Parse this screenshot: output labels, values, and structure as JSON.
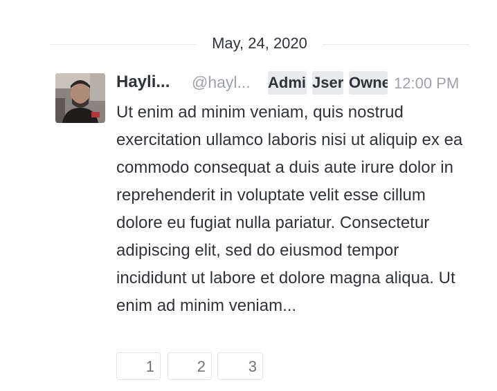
{
  "date_divider": {
    "label": "May, 24, 2020"
  },
  "message": {
    "username": "Hayli...",
    "handle": "@hayl...",
    "roles": [
      "Admir",
      "Jser",
      "Owne"
    ],
    "time": "12:00 PM",
    "body": "Ut enim ad minim veniam, quis nostrud exercitation ullamco laboris nisi ut aliquip ex ea commodo consequat a duis aute irure dolor in reprehenderit in voluptate velit esse cillum dolore eu fugiat nulla pariatur. Consectetur adipiscing elit, sed do eiusmod tempor incididunt ut labore et dolore magna aliqua. Ut enim ad minim veniam...",
    "reactions": [
      {
        "count": "1"
      },
      {
        "count": "2"
      },
      {
        "count": "3"
      }
    ]
  }
}
